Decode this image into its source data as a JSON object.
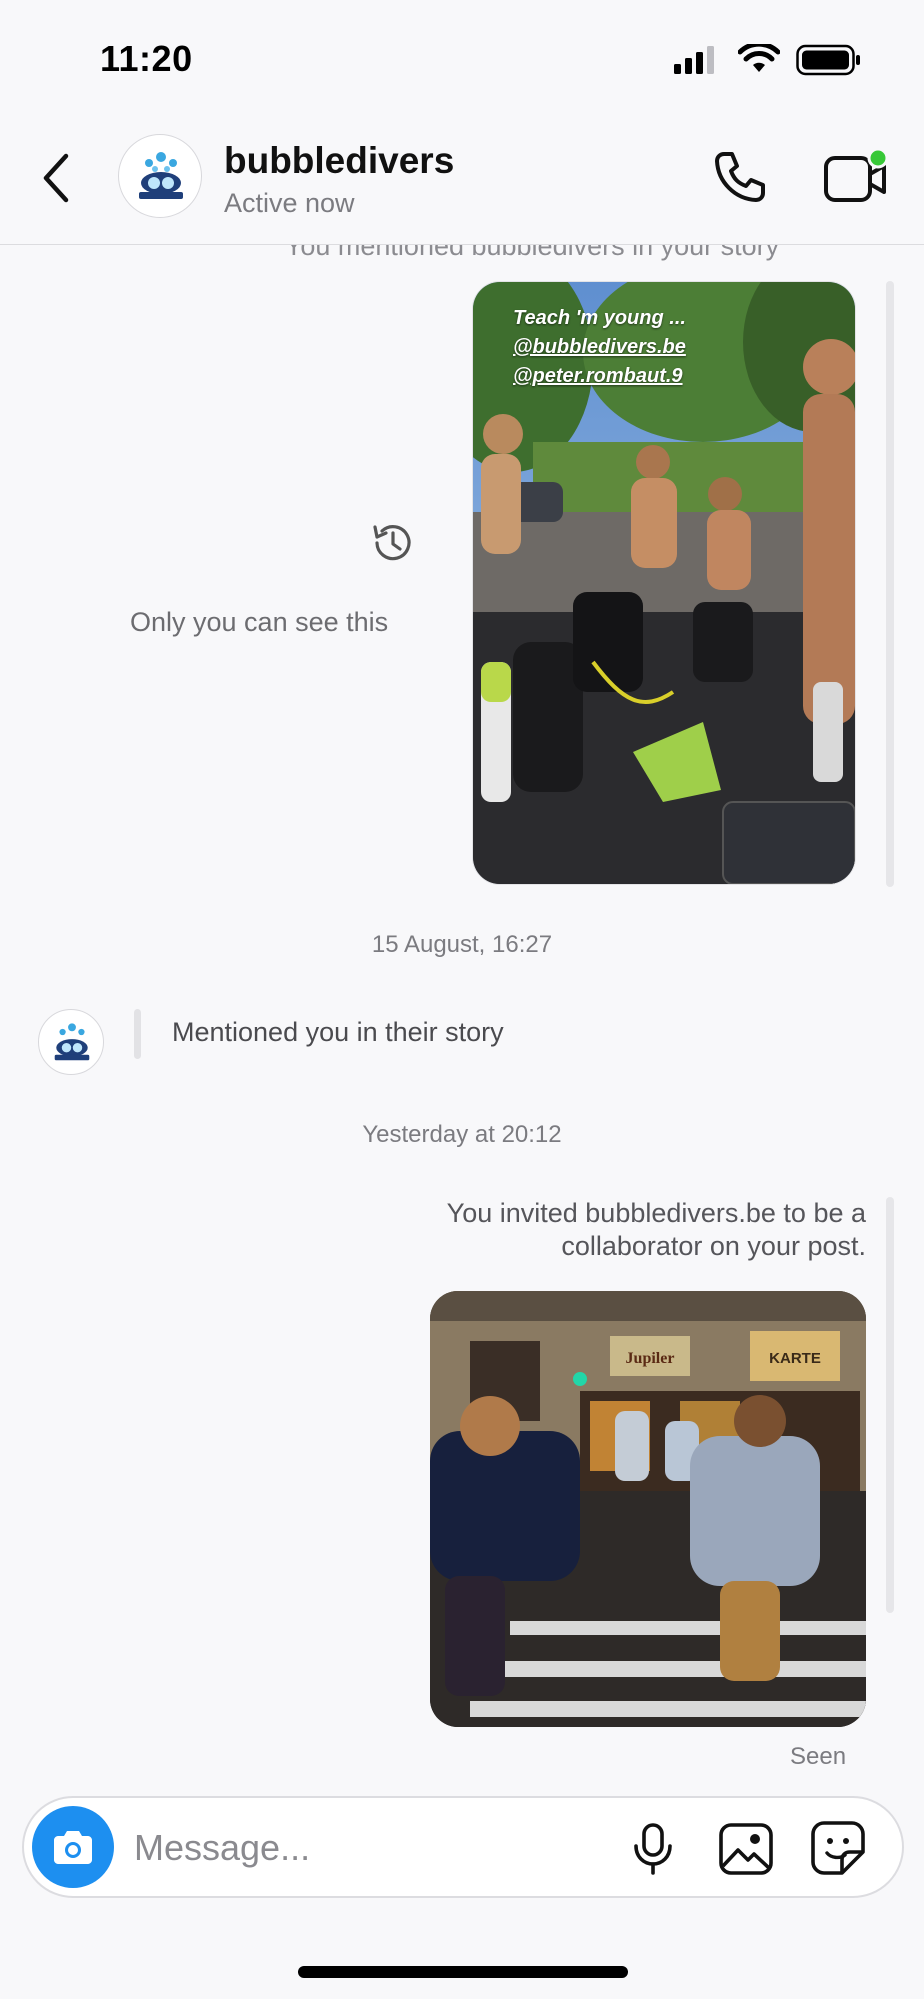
{
  "status_bar": {
    "time": "11:20"
  },
  "header": {
    "name": "bubbledivers",
    "status": "Active now"
  },
  "messages": {
    "clipped_note": "You mentioned bubbledivers in your story",
    "story": {
      "caption_lines": [
        "Teach 'm young ...",
        "@bubbledivers.be",
        "@peter.rombaut.9"
      ]
    },
    "private_notice": "Only you can see this",
    "date_1": "15 August, 16:27",
    "mention": "Mentioned you in their story",
    "date_2": "Yesterday at 20:12",
    "invite": "You invited bubbledivers.be to be a collaborator on your post.",
    "post_signs": [
      "Jupiler",
      "KARTE"
    ],
    "seen": "Seen"
  },
  "composer": {
    "placeholder": "Message..."
  },
  "icons": {
    "back": "chevron-left-icon",
    "call": "phone-icon",
    "video": "video-camera-icon",
    "history": "history-icon",
    "camera": "camera-icon",
    "mic": "microphone-icon",
    "gallery": "gallery-icon",
    "sticker": "sticker-icon"
  },
  "colors": {
    "accent_blue": "#1d8ff0",
    "active_dot": "#37c837",
    "background": "#f8f8fa"
  }
}
